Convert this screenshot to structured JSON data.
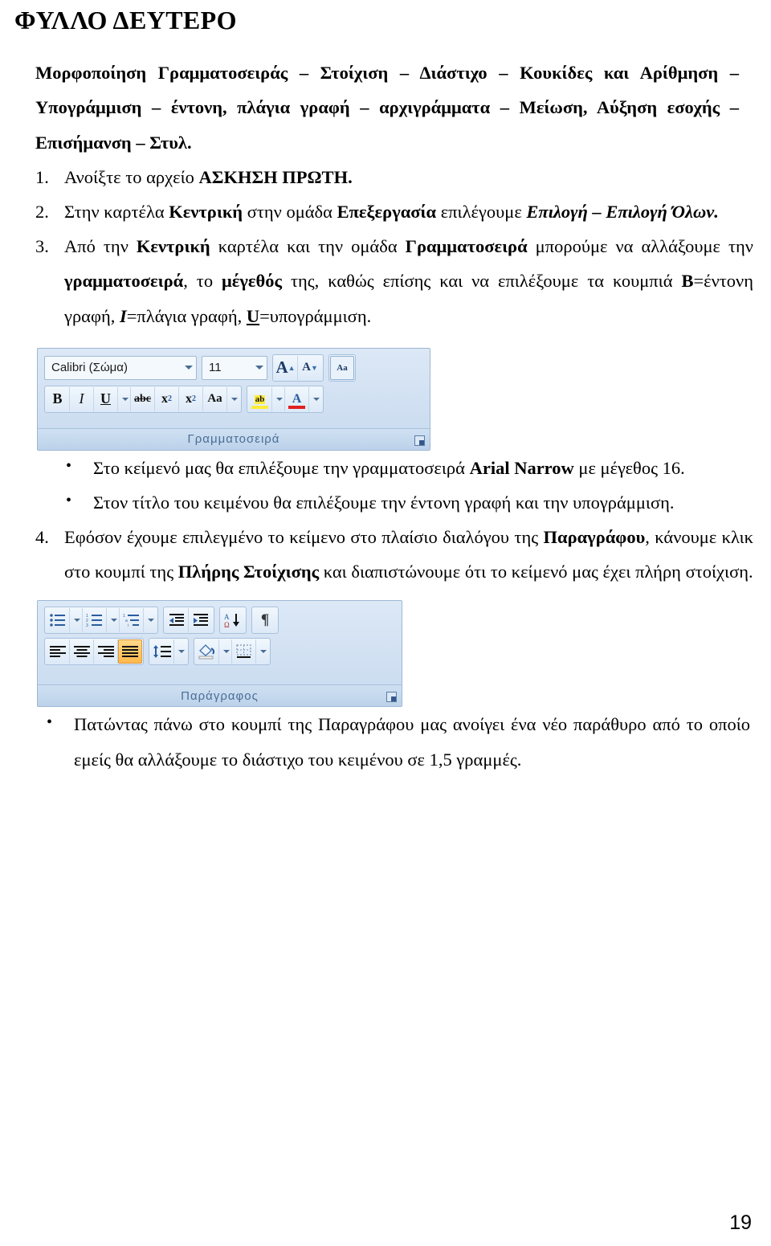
{
  "document": {
    "title": "ΦΥΛΛΟ ΔΕΥΤΕΡΟ",
    "intro_line1": "Μορφοποίηση Γραμματοσειράς – Στοίχιση – Διάστιχο – Κουκίδες και Αρίθμηση –",
    "intro_line2": "Υπογράμμιση – έντονη, πλάγια γραφή – αρχιγράμματα – Μείωση, Αύξηση εσοχής",
    "intro_line3": "– Επισήμανση – Στυλ.",
    "page_number": "19"
  },
  "steps": [
    {
      "number": "1.",
      "parts": [
        {
          "text": "Ανοίξτε το αρχείο ",
          "style": "normal"
        },
        {
          "text": "ΑΣΚΗΣΗ ΠΡΩΤΗ.",
          "style": "bold"
        }
      ]
    },
    {
      "number": "2.",
      "parts": [
        {
          "text": "Στην καρτέλα ",
          "style": "normal"
        },
        {
          "text": "Κεντρική",
          "style": "bold"
        },
        {
          "text": " στην ομάδα ",
          "style": "normal"
        },
        {
          "text": "Επεξεργασία",
          "style": "bold"
        },
        {
          "text": " επιλέγουμε ",
          "style": "normal"
        },
        {
          "text": "Επιλογή – Επιλογή Όλων.",
          "style": "bold-italic"
        }
      ]
    },
    {
      "number": "3.",
      "parts": [
        {
          "text": "Από την ",
          "style": "normal"
        },
        {
          "text": "Κεντρική",
          "style": "bold"
        },
        {
          "text": " καρτέλα και την ομάδα ",
          "style": "normal"
        },
        {
          "text": "Γραμματοσειρά",
          "style": "bold"
        },
        {
          "text": " μπορούμε να αλλάξουμε την ",
          "style": "normal"
        },
        {
          "text": "γραμματοσειρά",
          "style": "bold"
        },
        {
          "text": ", το ",
          "style": "normal"
        },
        {
          "text": "μέγεθός",
          "style": "bold"
        },
        {
          "text": " της, καθώς επίσης και να επιλέξουμε τα κουμπιά ",
          "style": "normal"
        },
        {
          "text": "B",
          "style": "bold"
        },
        {
          "text": "=έντονη γραφή, ",
          "style": "normal"
        },
        {
          "text": "I",
          "style": "bold-italic"
        },
        {
          "text": "=πλάγια γραφή, ",
          "style": "normal"
        },
        {
          "text": "U",
          "style": "bold-underline"
        },
        {
          "text": "=υπογράμμιση.",
          "style": "normal"
        }
      ]
    },
    {
      "number": "4.",
      "parts": [
        {
          "text": "Εφόσον έχουμε επιλεγμένο το κείμενο στο πλαίσιο διαλόγου της ",
          "style": "normal"
        },
        {
          "text": "Παραγράφου",
          "style": "bold"
        },
        {
          "text": ", κάνουμε κλικ στο κουμπί της ",
          "style": "normal"
        },
        {
          "text": "Πλήρης Στοίχισης",
          "style": "bold"
        },
        {
          "text": " και διαπιστώνουμε ότι το κείμενό μας έχει πλήρη στοίχιση.",
          "style": "normal"
        }
      ]
    }
  ],
  "bullets_font": [
    {
      "parts": [
        {
          "text": "Στο κείμενό μας θα επιλέξουμε την γραμματοσειρά ",
          "style": "normal"
        },
        {
          "text": "Arial Narrow",
          "style": "bold"
        },
        {
          "text": " με μέγεθος 16.",
          "style": "normal"
        }
      ]
    },
    {
      "parts": [
        {
          "text": "Στον τίτλο του κειμένου θα επιλέξουμε την έντονη γραφή και την υπογράμμιση.",
          "style": "normal"
        }
      ]
    }
  ],
  "bullets_paragraph": [
    {
      "parts": [
        {
          "text": "Πατώντας πάνω στο κουμπί της Παραγράφου μας ανοίγει ένα νέο παράθυρο από το οποίο εμείς θα αλλάξουμε το διάστιχο του κειμένου σε 1,5 γραμμές.",
          "style": "normal"
        }
      ]
    }
  ],
  "ribbon_font": {
    "group_label": "Γραμματοσειρά",
    "font_name": "Calibri (Σώμα)",
    "font_size": "11",
    "buttons_row1": [
      {
        "name": "grow-font",
        "glyph": "A"
      },
      {
        "name": "shrink-font",
        "glyph": "A"
      },
      {
        "name": "clear-formatting",
        "glyph": "Aa"
      }
    ],
    "buttons_row2": [
      {
        "name": "bold",
        "glyph": "B"
      },
      {
        "name": "italic",
        "glyph": "I"
      },
      {
        "name": "underline",
        "glyph": "U"
      },
      {
        "name": "strikethrough",
        "glyph": "abc"
      },
      {
        "name": "subscript",
        "glyph": "x₂"
      },
      {
        "name": "superscript",
        "glyph": "x²"
      },
      {
        "name": "change-case",
        "glyph": "Aa"
      },
      {
        "name": "text-highlight-color",
        "glyph": "ab"
      },
      {
        "name": "font-color",
        "glyph": "A"
      }
    ],
    "highlight_color": "#ffec3b",
    "font_color": "#e02020"
  },
  "ribbon_paragraph": {
    "group_label": "Παράγραφος",
    "buttons_row1": [
      {
        "name": "bullets",
        "glyph": "•≡"
      },
      {
        "name": "numbering",
        "glyph": "1≡"
      },
      {
        "name": "multilevel-list",
        "glyph": "1a"
      },
      {
        "name": "decrease-indent",
        "glyph": "⇤"
      },
      {
        "name": "increase-indent",
        "glyph": "⇥"
      },
      {
        "name": "sort",
        "glyph": "AΩ↓"
      },
      {
        "name": "show-formatting-marks",
        "glyph": "¶"
      }
    ],
    "buttons_row2": [
      {
        "name": "align-left",
        "glyph": "≡",
        "selected": false
      },
      {
        "name": "align-center",
        "glyph": "≡",
        "selected": false
      },
      {
        "name": "align-right",
        "glyph": "≡",
        "selected": false
      },
      {
        "name": "justify",
        "glyph": "≡",
        "selected": true
      },
      {
        "name": "line-spacing",
        "glyph": "↕≡"
      },
      {
        "name": "shading",
        "glyph": "paint"
      },
      {
        "name": "borders",
        "glyph": "borders"
      }
    ],
    "selected_color": "#ffb94b"
  }
}
